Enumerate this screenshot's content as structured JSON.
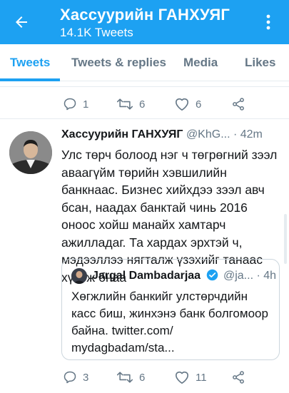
{
  "header": {
    "title": "Хассуурийн ГАНХУЯГ",
    "subtitle": "14.1K Tweets",
    "back_icon": "arrow-left-icon",
    "more_icon": "more-vertical-icon"
  },
  "tabs": [
    {
      "label": "Tweets",
      "active": true
    },
    {
      "label": "Tweets & replies",
      "active": false
    },
    {
      "label": "Media",
      "active": false
    },
    {
      "label": "Likes",
      "active": false
    }
  ],
  "prev_tweet": {
    "replies": "1",
    "retweets": "6",
    "likes": "6"
  },
  "tweet": {
    "author": "Хассуурийн ГАНХУЯГ",
    "handle": "@KhG...",
    "time": "· 42m",
    "text": "Улс төрч болоод нэг ч төгрөгний зээл аваагүйм төрийн хэвшилийн банкнаас. Бизнес хийхдээ зээл авч бсан, наадах банктай чинь 2016 оноос хойш манайх хамтарч ажилладаг. Та хардах эрхтэй ч, мэдээллээ нягталж үзэхийг танаас хүсэж бнаа",
    "quote": {
      "author": "Jargal Dambadarjaa",
      "handle": "@ja...",
      "time": "· 4h",
      "text": "Хөгжлийн банкийг улстөрчдийн касс биш, жинхэнэ банк болгомоор байна. twitter.com/ mydagbadam/sta..."
    },
    "replies": "3",
    "retweets": "6",
    "likes": "11"
  },
  "colors": {
    "brand": "#1da1f2",
    "muted": "#657786",
    "verified": "#1da1f2"
  }
}
